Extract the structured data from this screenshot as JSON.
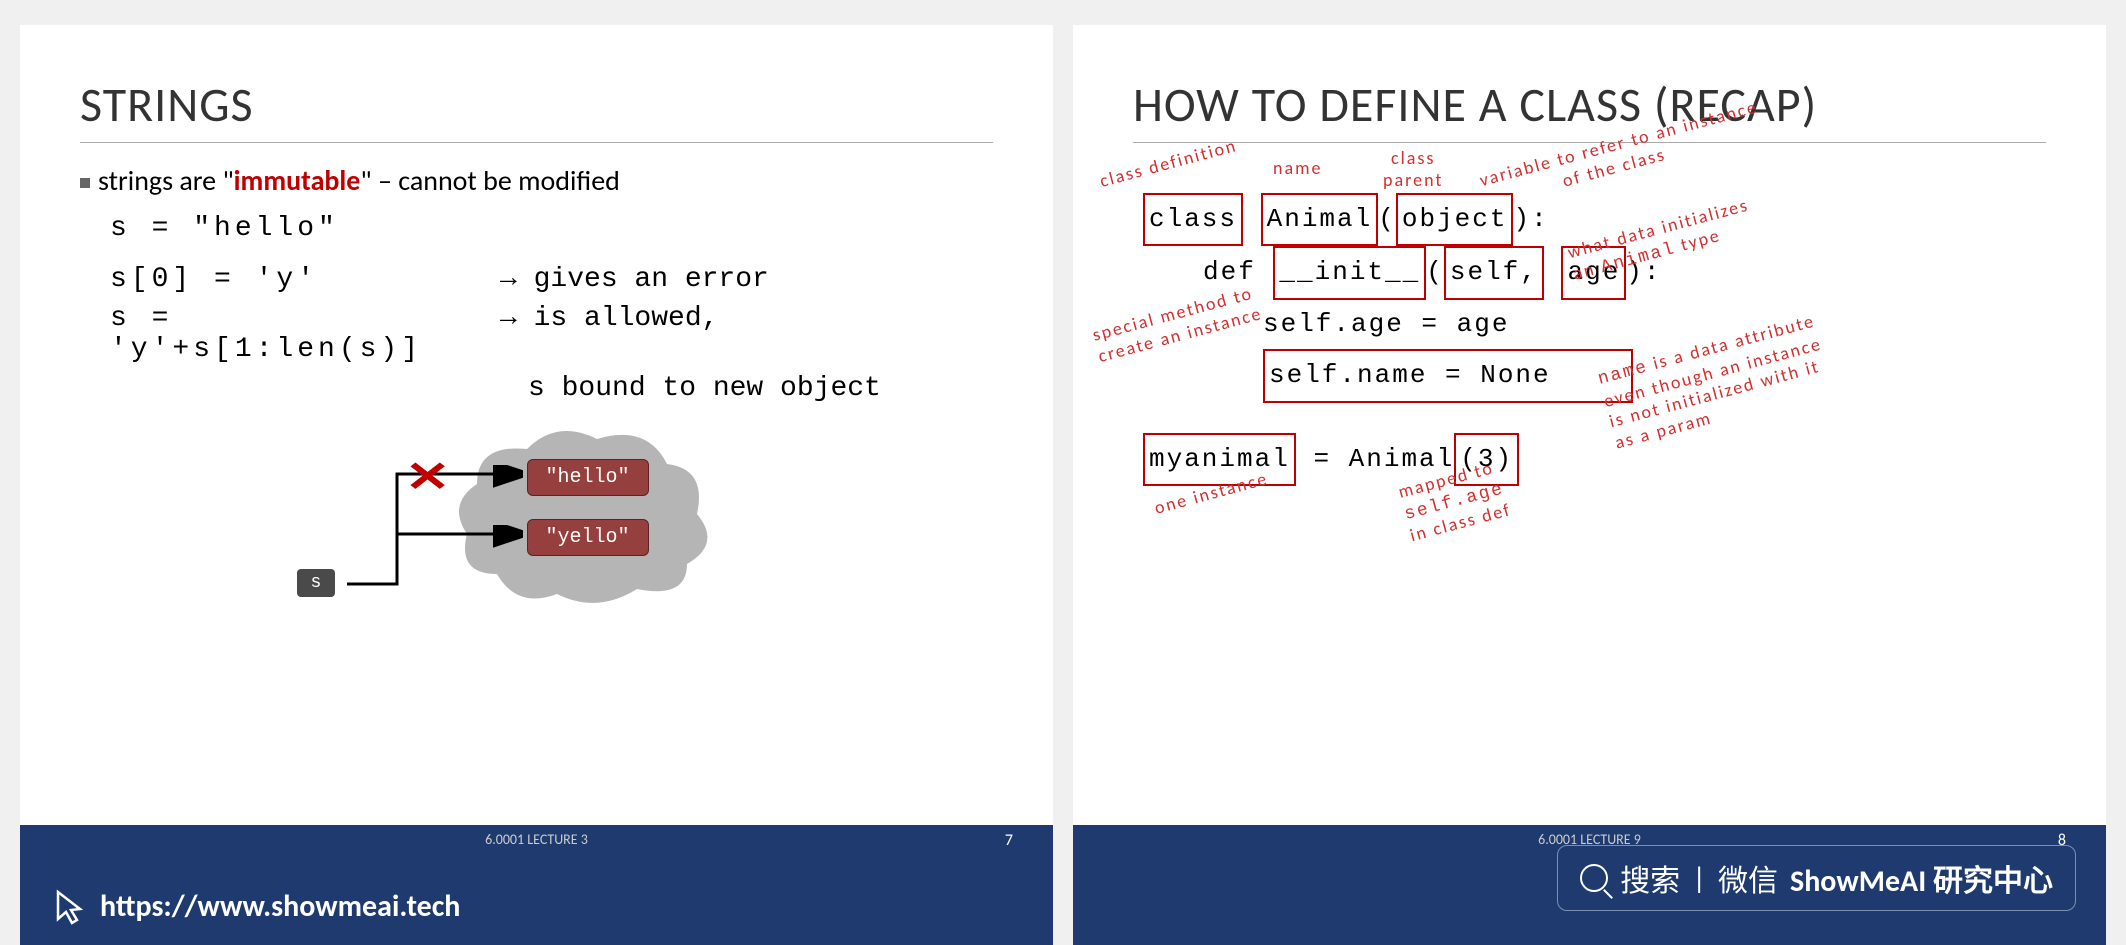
{
  "slide_left": {
    "title": "STRINGS",
    "bullet1_pre": "strings are \"",
    "bullet1_emph": "immutable",
    "bullet1_post": "\" – cannot be modified",
    "code1": "s = \"hello\"",
    "code2": "s[0] = 'y'",
    "code2_note": "→ gives an error",
    "code3": "s = 'y'+s[1:len(s)]",
    "code3_note1": "→ is allowed,",
    "code3_note2": "s bound to new object",
    "box_hello": "\"hello\"",
    "box_yello": "\"yello\"",
    "var_s": "s",
    "footer_label": "6.0001 LECTURE 3",
    "page": "7",
    "url": "https://www.showmeai.tech"
  },
  "slide_right": {
    "title": "HOW TO DEFINE A CLASS (RECAP)",
    "code_class": "class",
    "code_animal": "Animal",
    "code_object": "object",
    "code_def": "def",
    "code_init": "__init__",
    "code_self": "self,",
    "code_age": "age",
    "code_line3": "self.age = age",
    "code_line4": "self.name = None",
    "code_myanimal": "myanimal",
    "code_assign": "= Animal",
    "code_three": "(3)",
    "anno_classdef": "class definition",
    "anno_name": "name",
    "anno_parent": "class\nparent",
    "anno_varref1": "variable to refer to an instance",
    "anno_varref2": "of the class",
    "anno_data1": "what data initializes",
    "anno_data2": "an",
    "anno_data2_mono": "Animal",
    "anno_data2_post": "type",
    "anno_special1": "special method to",
    "anno_special2": "create an instance",
    "anno_nameattr1": "name",
    "anno_nameattr1_post": "is a data attribute",
    "anno_nameattr2": "even though an instance",
    "anno_nameattr3": "is not initialized with it",
    "anno_nameattr4": "as a param",
    "anno_one": "one instance",
    "anno_mapped1": "mapped to",
    "anno_mapped2": "self.age",
    "anno_mapped3": "in class def",
    "footer_label": "6.0001 LECTURE 9",
    "page": "8",
    "search_text1": "搜索",
    "search_sep": "|",
    "search_text2": "微信",
    "search_text3": "ShowMeAI 研究中心"
  }
}
